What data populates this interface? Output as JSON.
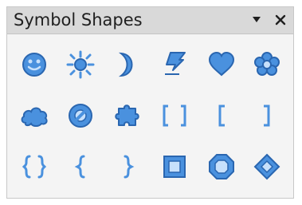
{
  "window": {
    "title": "Symbol Shapes"
  },
  "controls": {
    "menu_icon": "triangle-down-icon",
    "close_icon": "close-icon"
  },
  "colors": {
    "panel_bg": "#f4f4f4",
    "titlebar_bg": "#d9d9d9",
    "icon_fill": "#4a91de",
    "icon_stroke": "#2a66b0",
    "icon_light": "#c7e0fb"
  },
  "symbols": [
    "smiley-face-icon",
    "sun-icon",
    "moon-icon",
    "lightning-bolt-icon",
    "heart-icon",
    "flower-icon",
    "cloud-icon",
    "prohibited-icon",
    "puzzle-icon",
    "double-bracket-icon",
    "left-bracket-icon",
    "right-bracket-icon",
    "double-brace-icon",
    "left-brace-icon",
    "right-brace-icon",
    "square-bevel-icon",
    "octagon-bevel-icon",
    "diamond-bevel-icon"
  ]
}
